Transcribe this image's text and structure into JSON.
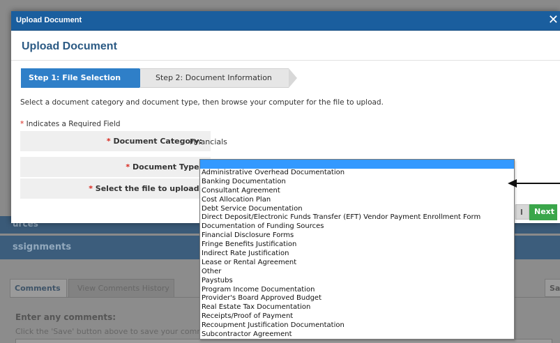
{
  "background": {
    "bar1_label": "urces",
    "bar2_label": "ssignments",
    "tabs": [
      "Comments",
      "View Comments History"
    ],
    "save_tab_label": "Sa",
    "comments_label": "Enter any comments:",
    "comments_hint": "Click the 'Save' button above to save your comm"
  },
  "modal": {
    "titlebar": "Upload Document",
    "heading": "Upload Document",
    "close_glyph": "✕",
    "steps": [
      "Step 1: File Selection",
      "Step 2: Document Information"
    ],
    "instructions": "Select a document category and document type, then browse your computer for the file to upload.",
    "required_star": "*",
    "required_note": "Indicates a Required Field",
    "fields": {
      "category_label": "Document Category:",
      "category_value": "Financials",
      "type_label": "Document Type:",
      "file_label": "Select the file to upload:"
    },
    "buttons": {
      "dim_label": "l",
      "next_label": "Next"
    }
  },
  "dropdown": {
    "options": [
      "Administrative Overhead Documentation",
      "Banking Documentation",
      "Consultant Agreement",
      "Cost Allocation Plan",
      "Debt Service Documentation",
      "Direct Deposit/Electronic Funds Transfer (EFT) Vendor Payment Enrollment Form",
      "Documentation of Funding Sources",
      "Financial Disclosure Forms",
      "Fringe Benefits Justification",
      "Indirect Rate Justification",
      "Lease or Rental Agreement",
      "Other",
      "Paystubs",
      "Program Income Documentation",
      "Provider's Board Approved Budget",
      "Real Estate Tax Documentation",
      "Receipts/Proof of Payment",
      "Recoupment Justification Documentation",
      "Subcontractor Agreement"
    ]
  },
  "colors": {
    "titlebar": "#1a5e9e",
    "heading": "#2b5a84",
    "step_active": "#2f7fc8",
    "required": "#d9261c",
    "next_button": "#3aa64a",
    "dropdown_highlight": "#3399ff"
  }
}
